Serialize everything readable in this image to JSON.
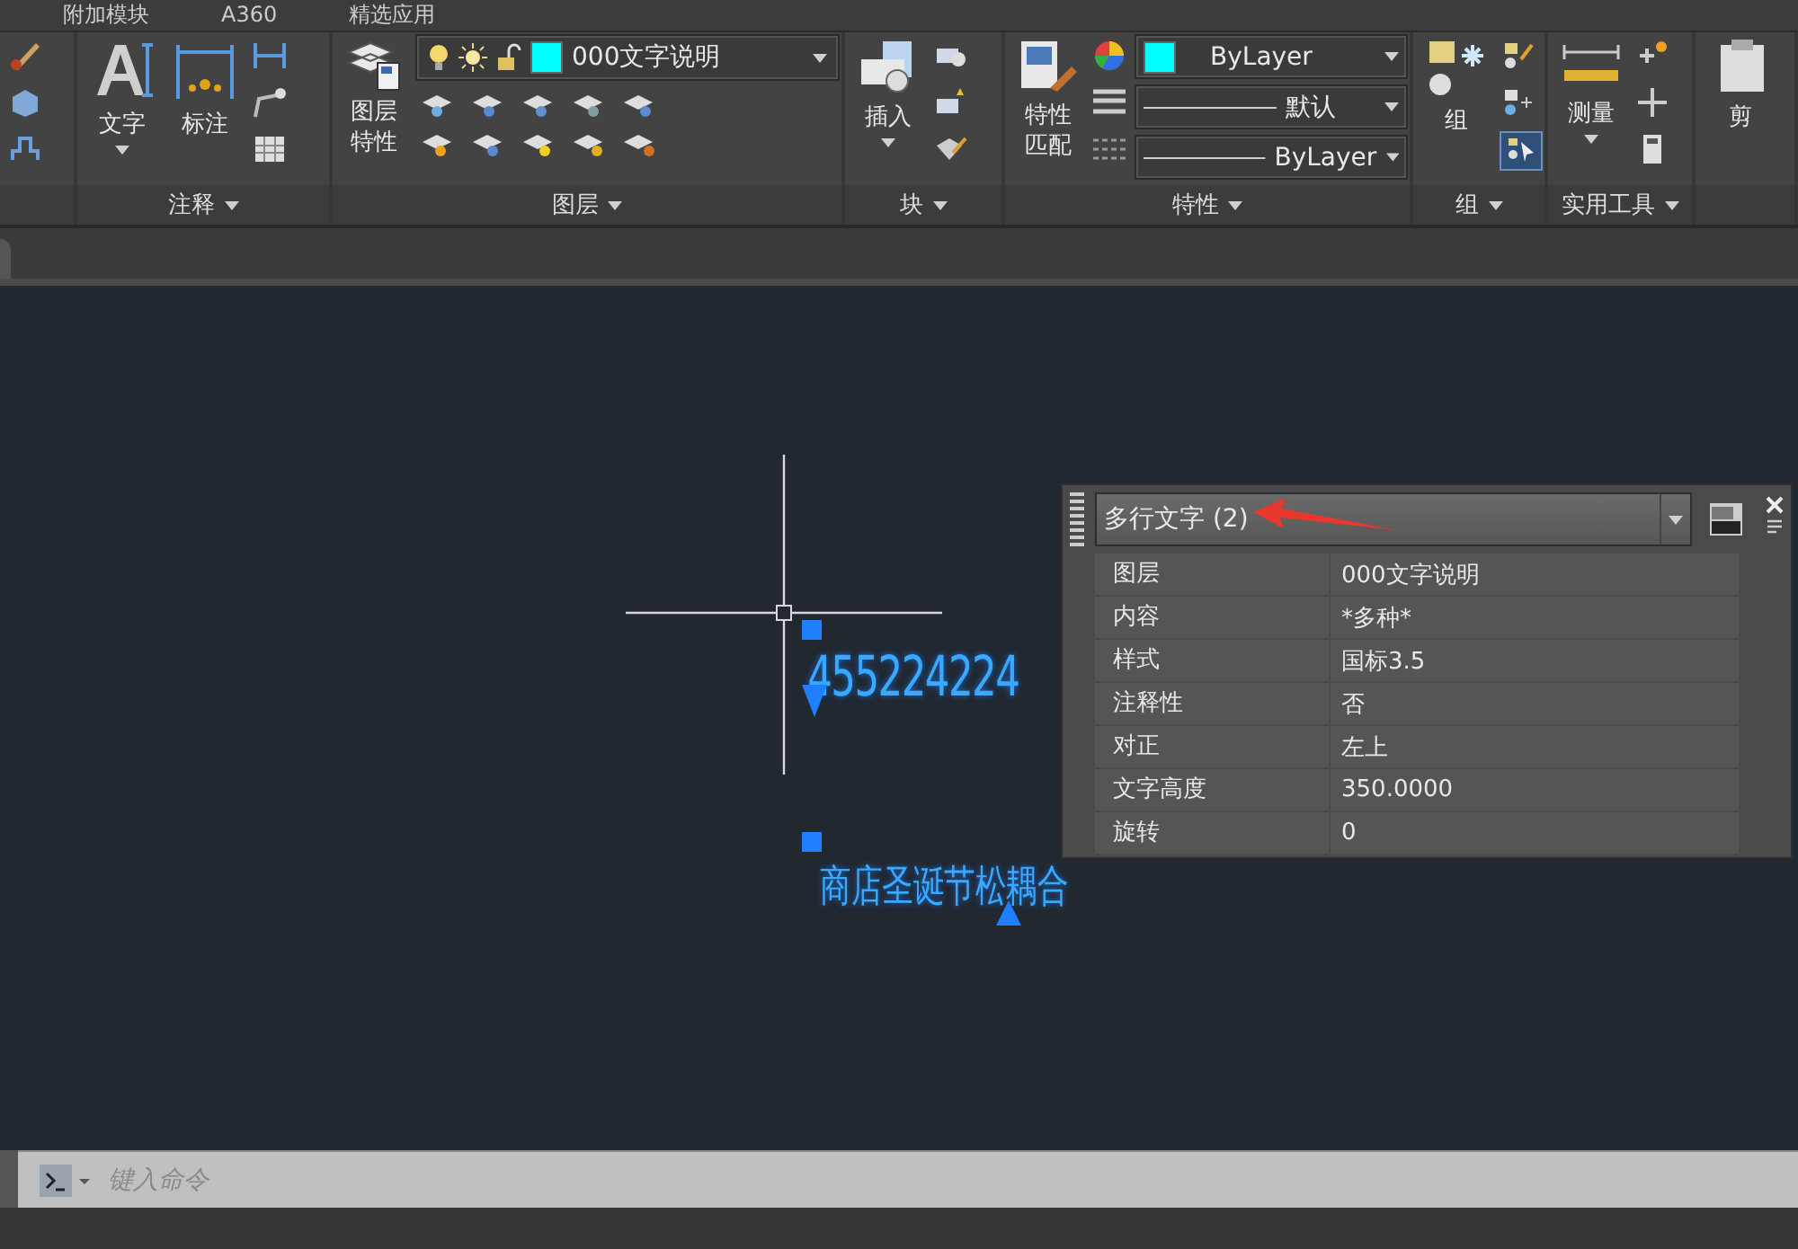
{
  "menu_tabs": [
    "附加模块",
    "A360",
    "精选应用"
  ],
  "ribbon": [
    {
      "kind": "modify"
    },
    {
      "kind": "annotation",
      "title": "注释",
      "buttons": [
        "文字",
        "标注"
      ]
    },
    {
      "kind": "layers",
      "title": "图层",
      "button_lines": [
        "图层",
        "特性"
      ],
      "layer": {
        "value": "000文字说明",
        "color": "#00ffff"
      }
    },
    {
      "kind": "block",
      "title": "块",
      "buttons": [
        "插入"
      ]
    },
    {
      "kind": "properties",
      "title": "特性",
      "button_lines": [
        "特性",
        "匹配"
      ],
      "dropdowns": [
        {
          "kind": "color",
          "value": "ByLayer",
          "color": "#00ffff"
        },
        {
          "kind": "line",
          "value": "默认"
        },
        {
          "kind": "line",
          "value": "ByLayer"
        }
      ]
    },
    {
      "kind": "group",
      "title": "组",
      "buttons": [
        "组"
      ],
      "toggle_on": true
    },
    {
      "kind": "utilities",
      "title": "实用工具",
      "buttons": [
        "测量"
      ]
    },
    {
      "kind": "clipboard",
      "buttons": [
        "剪"
      ]
    }
  ],
  "canvas": {
    "texts": [
      {
        "kind": "number",
        "text": "455224224"
      },
      {
        "kind": "chinese",
        "text": "商店圣诞节松耦合"
      }
    ]
  },
  "properties_palette": {
    "selection": "多行文字 (2)",
    "rows": [
      {
        "label": "图层",
        "value": "000文字说明"
      },
      {
        "label": "内容",
        "value": "*多种*"
      },
      {
        "label": "样式",
        "value": "国标3.5"
      },
      {
        "label": "注释性",
        "value": "否"
      },
      {
        "label": "对正",
        "value": "左上"
      },
      {
        "label": "文字高度",
        "value": "350.0000"
      },
      {
        "label": "旋转",
        "value": "0"
      }
    ]
  },
  "command_line": {
    "placeholder": "键入命令"
  }
}
